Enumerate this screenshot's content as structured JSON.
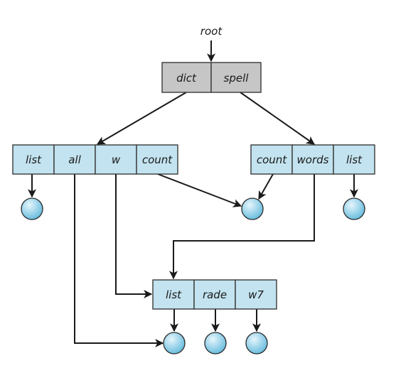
{
  "diagram": {
    "colors": {
      "root_fill": "#c6c6c6",
      "dir_fill": "#c2e3ef",
      "stroke": "#3a3a3a",
      "file_node_light": "#e6f6fc",
      "file_node_dark": "#5fb8dc"
    },
    "root_label": "root",
    "directories": [
      {
        "id": "root-dir",
        "entries": [
          "dict",
          "spell"
        ]
      },
      {
        "id": "dict-dir",
        "entries": [
          "list",
          "all",
          "w",
          "count"
        ]
      },
      {
        "id": "spell-dir",
        "entries": [
          "count",
          "words",
          "list"
        ]
      },
      {
        "id": "words-dir",
        "entries": [
          "list",
          "rade",
          "w7"
        ]
      }
    ],
    "file_nodes": [
      {
        "id": "file-dict-list"
      },
      {
        "id": "file-shared-count"
      },
      {
        "id": "file-spell-list"
      },
      {
        "id": "file-words-list"
      },
      {
        "id": "file-words-rade"
      },
      {
        "id": "file-words-w7"
      }
    ],
    "edges": [
      {
        "from": "root-label",
        "to": "root-dir"
      },
      {
        "from": "root-dir.dict",
        "to": "dict-dir"
      },
      {
        "from": "root-dir.spell",
        "to": "spell-dir"
      },
      {
        "from": "dict-dir.list",
        "to": "file-dict-list"
      },
      {
        "from": "dict-dir.all",
        "to": "file-words-list"
      },
      {
        "from": "dict-dir.w",
        "to": "words-dir"
      },
      {
        "from": "dict-dir.count",
        "to": "file-shared-count"
      },
      {
        "from": "spell-dir.count",
        "to": "file-shared-count"
      },
      {
        "from": "spell-dir.words",
        "to": "words-dir"
      },
      {
        "from": "spell-dir.list",
        "to": "file-spell-list"
      },
      {
        "from": "words-dir.list",
        "to": "file-words-list"
      },
      {
        "from": "words-dir.rade",
        "to": "file-words-rade"
      },
      {
        "from": "words-dir.w7",
        "to": "file-words-w7"
      }
    ]
  }
}
